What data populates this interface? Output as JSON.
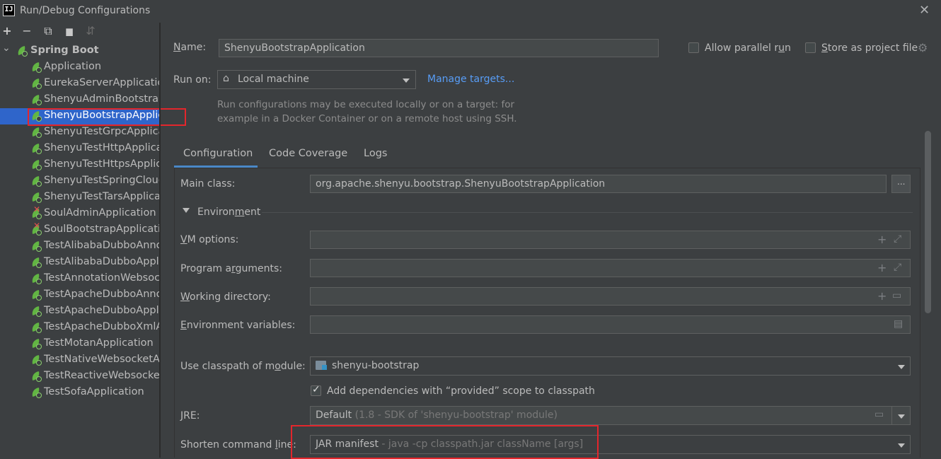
{
  "window": {
    "logo_text": "IJ",
    "title": "Run/Debug Configurations",
    "close_glyph": "✕"
  },
  "toolbar": {
    "add_glyph": "+",
    "remove_glyph": "−",
    "copy_glyph": "⧉",
    "folder_glyph": "▆",
    "sort_glyph": "⇵"
  },
  "tree": {
    "root_arrow": "⌄",
    "root_label": "Spring Boot",
    "items": [
      {
        "label": "Application",
        "selected": false,
        "error": false
      },
      {
        "label": "EurekaServerApplication",
        "selected": false,
        "error": false
      },
      {
        "label": "ShenyuAdminBootstrap",
        "selected": false,
        "error": false
      },
      {
        "label": "ShenyuBootstrapApplica",
        "selected": true,
        "error": false
      },
      {
        "label": "ShenyuTestGrpcApplicat",
        "selected": false,
        "error": false
      },
      {
        "label": "ShenyuTestHttpApplicati",
        "selected": false,
        "error": false
      },
      {
        "label": "ShenyuTestHttpsApplicat",
        "selected": false,
        "error": false
      },
      {
        "label": "ShenyuTestSpringCloudA",
        "selected": false,
        "error": false
      },
      {
        "label": "ShenyuTestTarsApplicati",
        "selected": false,
        "error": false
      },
      {
        "label": "SoulAdminApplication",
        "selected": false,
        "error": true
      },
      {
        "label": "SoulBootstrapApplicatio",
        "selected": false,
        "error": true
      },
      {
        "label": "TestAlibabaDubboAnnot",
        "selected": false,
        "error": false
      },
      {
        "label": "TestAlibabaDubboApplic",
        "selected": false,
        "error": false
      },
      {
        "label": "TestAnnotationWebsock",
        "selected": false,
        "error": false
      },
      {
        "label": "TestApacheDubboAnnot",
        "selected": false,
        "error": false
      },
      {
        "label": "TestApacheDubboApplic",
        "selected": false,
        "error": false
      },
      {
        "label": "TestApacheDubboXmlAp",
        "selected": false,
        "error": false
      },
      {
        "label": "TestMotanApplication",
        "selected": false,
        "error": false
      },
      {
        "label": "TestNativeWebsocketAp",
        "selected": false,
        "error": false
      },
      {
        "label": "TestReactiveWebsocketA",
        "selected": false,
        "error": false
      },
      {
        "label": "TestSofaApplication",
        "selected": false,
        "error": false
      }
    ]
  },
  "header": {
    "name_label_u": "N",
    "name_label_rest": "ame:",
    "name_value": "ShenyuBootstrapApplication",
    "allow_parallel_label_a": "Allow parallel r",
    "allow_parallel_label_u": "u",
    "allow_parallel_label_b": "n",
    "allow_parallel_checked": false,
    "store_label_u": "S",
    "store_label_rest": "tore as project file",
    "store_checked": false,
    "run_on_label": "Run on:",
    "run_on_value": "Local machine",
    "manage_targets": "Manage targets...",
    "help_line1": "Run configurations may be executed locally or on a target: for",
    "help_line2": "example in a Docker Container or on a remote host using SSH."
  },
  "tabs": [
    "Configuration",
    "Code Coverage",
    "Logs"
  ],
  "config": {
    "main_class_label": "Main class:",
    "main_class_value": "org.apache.shenyu.bootstrap.ShenyuBootstrapApplication",
    "browse_glyph": "...",
    "environment_label_a": "Environ",
    "environment_label_u": "m",
    "environment_label_b": "ent",
    "vm_options_label_u": "V",
    "vm_options_label_rest": "M options:",
    "program_args_label_a": "Program a",
    "program_args_label_u": "r",
    "program_args_label_b": "guments:",
    "working_dir_label_u": "W",
    "working_dir_label_rest": "orking directory:",
    "env_vars_label_u": "E",
    "env_vars_label_rest": "nvironment variables:",
    "classpath_label_a": "Use classpath of m",
    "classpath_label_u": "o",
    "classpath_label_b": "dule:",
    "classpath_value": "shenyu-bootstrap",
    "add_deps_label": "Add dependencies with “provided” scope to classpath",
    "add_deps_checked": true,
    "jre_label_u": "J",
    "jre_label_rest": "RE:",
    "jre_value": "Default",
    "jre_hint": " (1.8 - SDK of 'shenyu-bootstrap' module)",
    "shorten_label_a": "Shorten command ",
    "shorten_label_u": "l",
    "shorten_label_b": "ine:",
    "shorten_value": "JAR manifest",
    "shorten_hint": " - java -cp classpath.jar className [args]"
  }
}
